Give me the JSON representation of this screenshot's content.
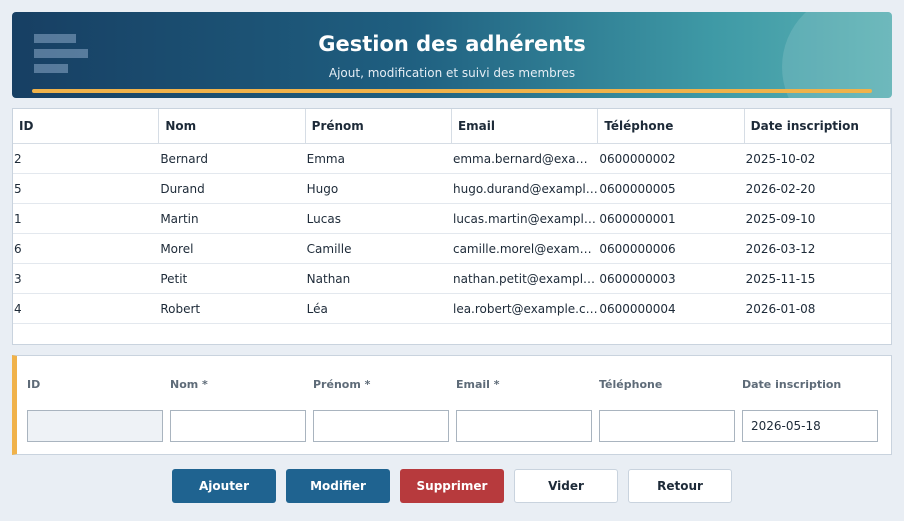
{
  "header": {
    "title": "Gestion des adhérents",
    "subtitle": "Ajout, modification et suivi des membres",
    "menu_icon": "hamburger-icon",
    "accent_color": "#f0b24a"
  },
  "table": {
    "columns": [
      "ID",
      "Nom",
      "Prénom",
      "Email",
      "Téléphone",
      "Date inscription"
    ],
    "rows": [
      [
        "2",
        "Bernard",
        "Emma",
        "emma.bernard@example.com",
        "0600000002",
        "2025-10-02"
      ],
      [
        "5",
        "Durand",
        "Hugo",
        "hugo.durand@example.com",
        "0600000005",
        "2026-02-20"
      ],
      [
        "1",
        "Martin",
        "Lucas",
        "lucas.martin@example.com",
        "0600000001",
        "2025-09-10"
      ],
      [
        "6",
        "Morel",
        "Camille",
        "camille.morel@example.com",
        "0600000006",
        "2026-03-12"
      ],
      [
        "3",
        "Petit",
        "Nathan",
        "nathan.petit@example.com",
        "0600000003",
        "2025-11-15"
      ],
      [
        "4",
        "Robert",
        "Léa",
        "lea.robert@example.com",
        "0600000004",
        "2026-01-08"
      ]
    ]
  },
  "form": {
    "id": {
      "label": "ID",
      "value": ""
    },
    "nom": {
      "label": "Nom *",
      "value": ""
    },
    "prenom": {
      "label": "Prénom *",
      "value": ""
    },
    "email": {
      "label": "Email *",
      "value": ""
    },
    "telephone": {
      "label": "Téléphone",
      "value": ""
    },
    "date": {
      "label": "Date inscription",
      "value": "2026-05-18"
    }
  },
  "buttons": {
    "add": "Ajouter",
    "edit": "Modifier",
    "delete": "Supprimer",
    "clear": "Vider",
    "back": "Retour"
  },
  "colors": {
    "primary": "#1f6390",
    "danger": "#b73a3d"
  }
}
